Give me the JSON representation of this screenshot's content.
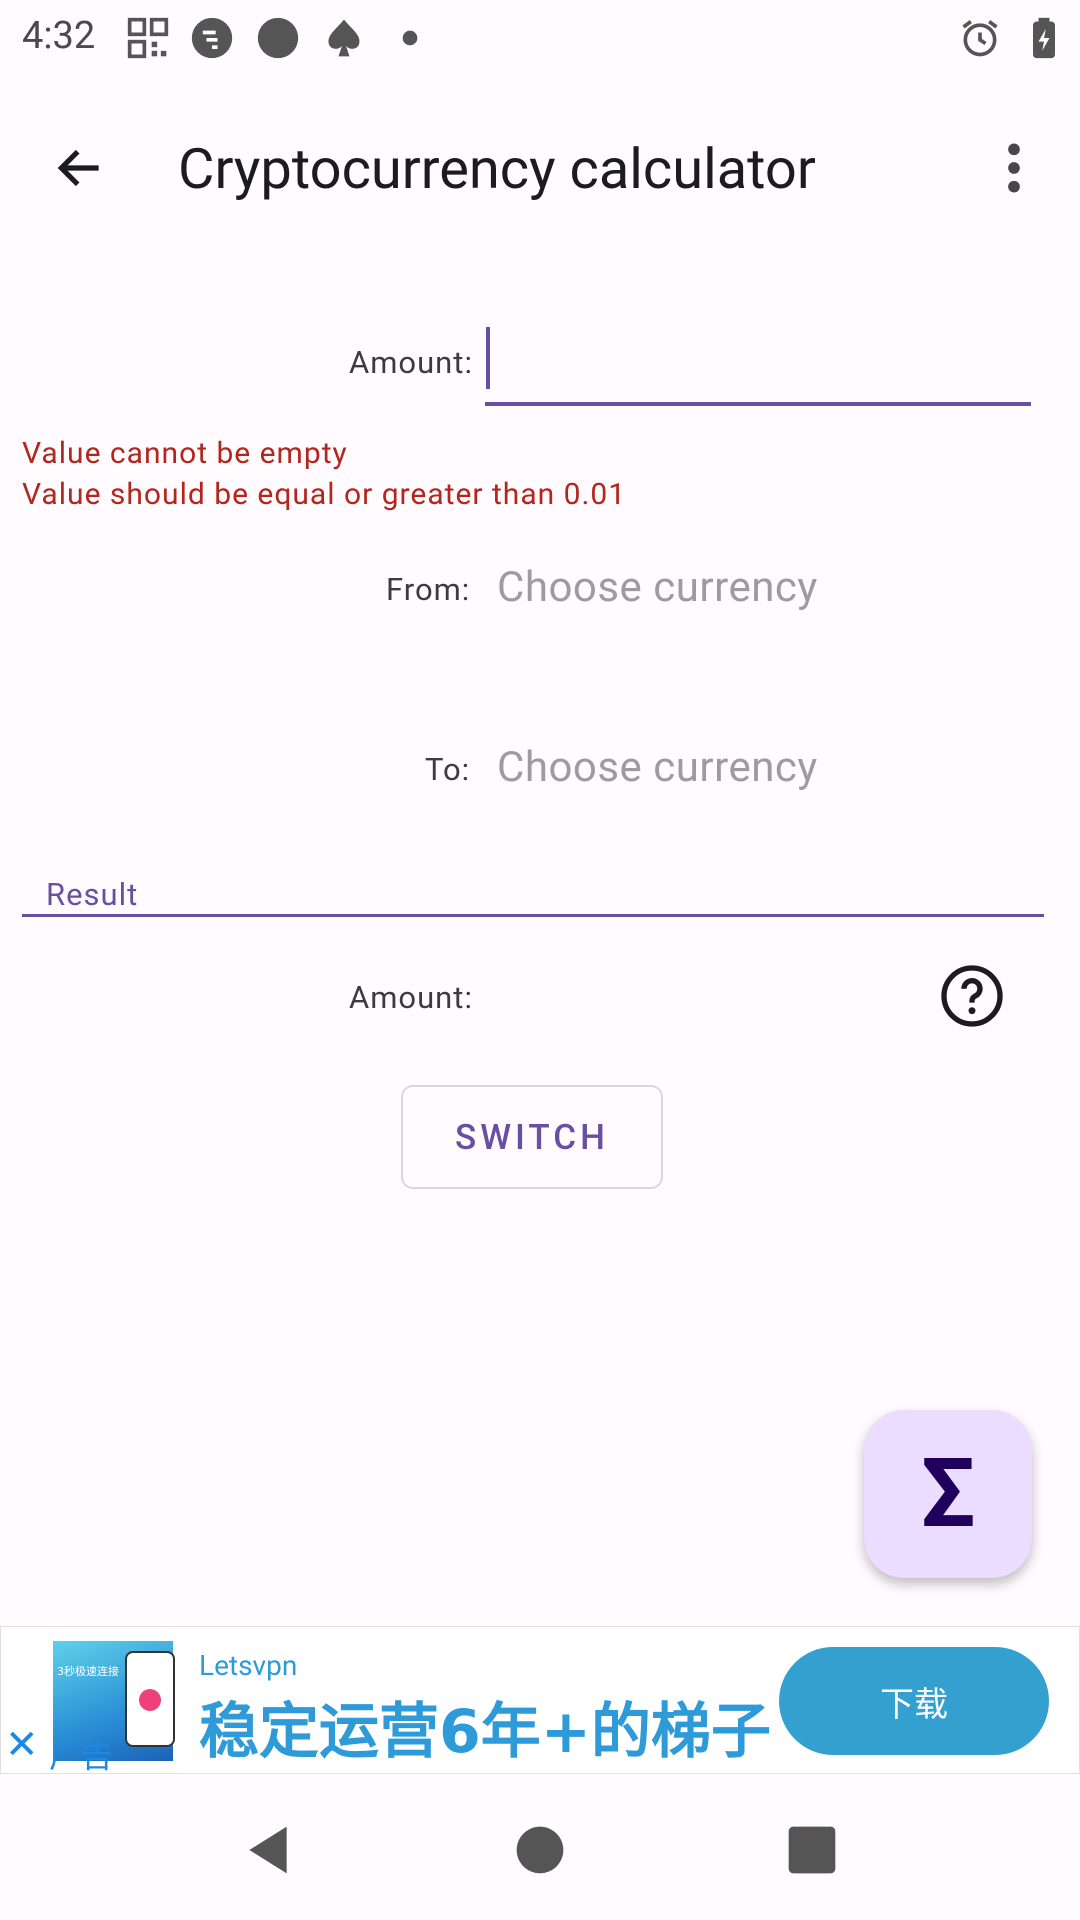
{
  "status_bar": {
    "time": "4:32",
    "left_icons": [
      "qr-code-icon",
      "chat-bubble-icon",
      "circle-icon",
      "spade-icon",
      "dot-icon"
    ],
    "right_icons": [
      "alarm-icon",
      "battery-charging-icon"
    ]
  },
  "app_bar": {
    "title": "Cryptocurrency calculator",
    "back_icon": "arrow-back-icon",
    "menu_icon": "more-vert-icon"
  },
  "form": {
    "amount_label": "Amount:",
    "amount_value": "",
    "errors": [
      "Value cannot be empty",
      "Value should be equal or greater than 0.01"
    ],
    "from_label": "From:",
    "from_placeholder": "Choose currency",
    "to_label": "To:",
    "to_placeholder": "Choose currency"
  },
  "result": {
    "section_label": "Result",
    "amount_label": "Amount:",
    "amount_value": "",
    "help_icon": "help-circle-icon"
  },
  "switch_button": "SWITCH",
  "fab": {
    "glyph": "Σ",
    "icon": "sigma-icon"
  },
  "ad": {
    "sponsor": "Letsvpn",
    "headline": "稳定运营6年+的梯子",
    "cta": "下载",
    "tag": "广告",
    "close_glyph": "✕",
    "thumb_text": "3秒极速连接"
  },
  "colors": {
    "accent": "#6750a4",
    "error": "#b3261e",
    "fab_bg": "#eaddff",
    "ad_blue": "#33a0d0"
  }
}
